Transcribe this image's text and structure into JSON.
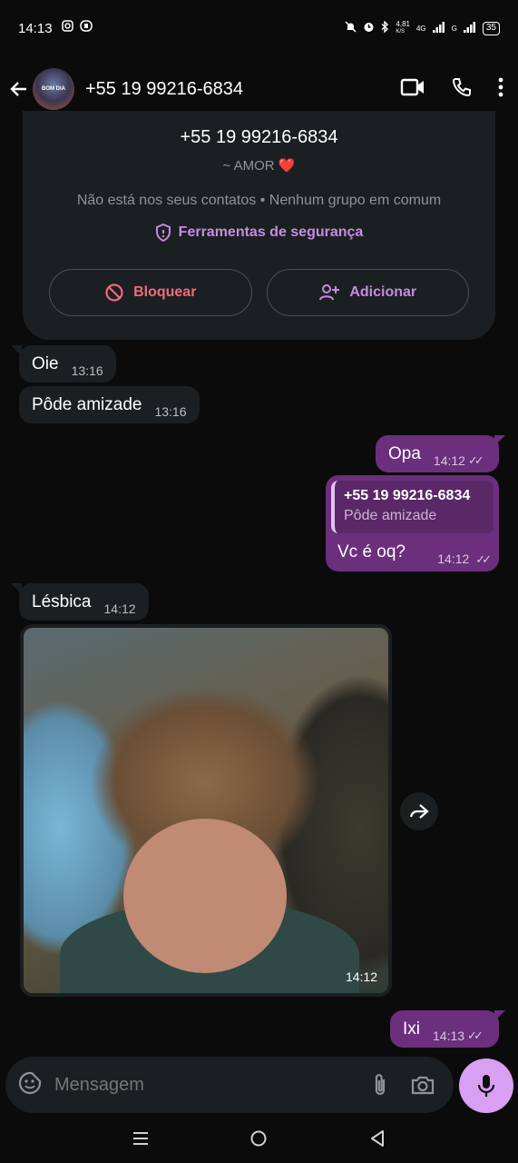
{
  "status_bar": {
    "time": "14:13",
    "net_speed": "4,81",
    "net_unit": "K/S",
    "network": "4G",
    "network2": "G",
    "battery": "35"
  },
  "header": {
    "avatar_text": "BOM DIA",
    "title": "+55 19 99216-6834"
  },
  "info_card": {
    "phone": "+55 19 99216-6834",
    "about": "~ AMOR ❤️",
    "note": "Não está nos seus contatos • Nenhum grupo em comum",
    "safety_link": "Ferramentas de segurança",
    "block_label": "Bloquear",
    "add_label": "Adicionar"
  },
  "messages": [
    {
      "dir": "in",
      "text": "Oie",
      "time": "13:16"
    },
    {
      "dir": "in",
      "text": "Pôde amizade",
      "time": "13:16"
    },
    {
      "dir": "out",
      "text": "Opa",
      "time": "14:12"
    },
    {
      "dir": "out",
      "text": "Vc é oq?",
      "time": "14:12",
      "quote_name": "+55 19 99216-6834",
      "quote_text": "Pôde amizade"
    },
    {
      "dir": "in",
      "text": "Lésbica",
      "time": "14:12"
    },
    {
      "dir": "in",
      "type": "image",
      "time": "14:12"
    },
    {
      "dir": "out",
      "text": "Ixi",
      "time": "14:13"
    }
  ],
  "composer": {
    "placeholder": "Mensagem"
  },
  "colors": {
    "accent": "#d99ff2",
    "out_bubble": "#6b2f7d",
    "in_bubble": "#1c1f21",
    "danger": "#f06a7d"
  }
}
